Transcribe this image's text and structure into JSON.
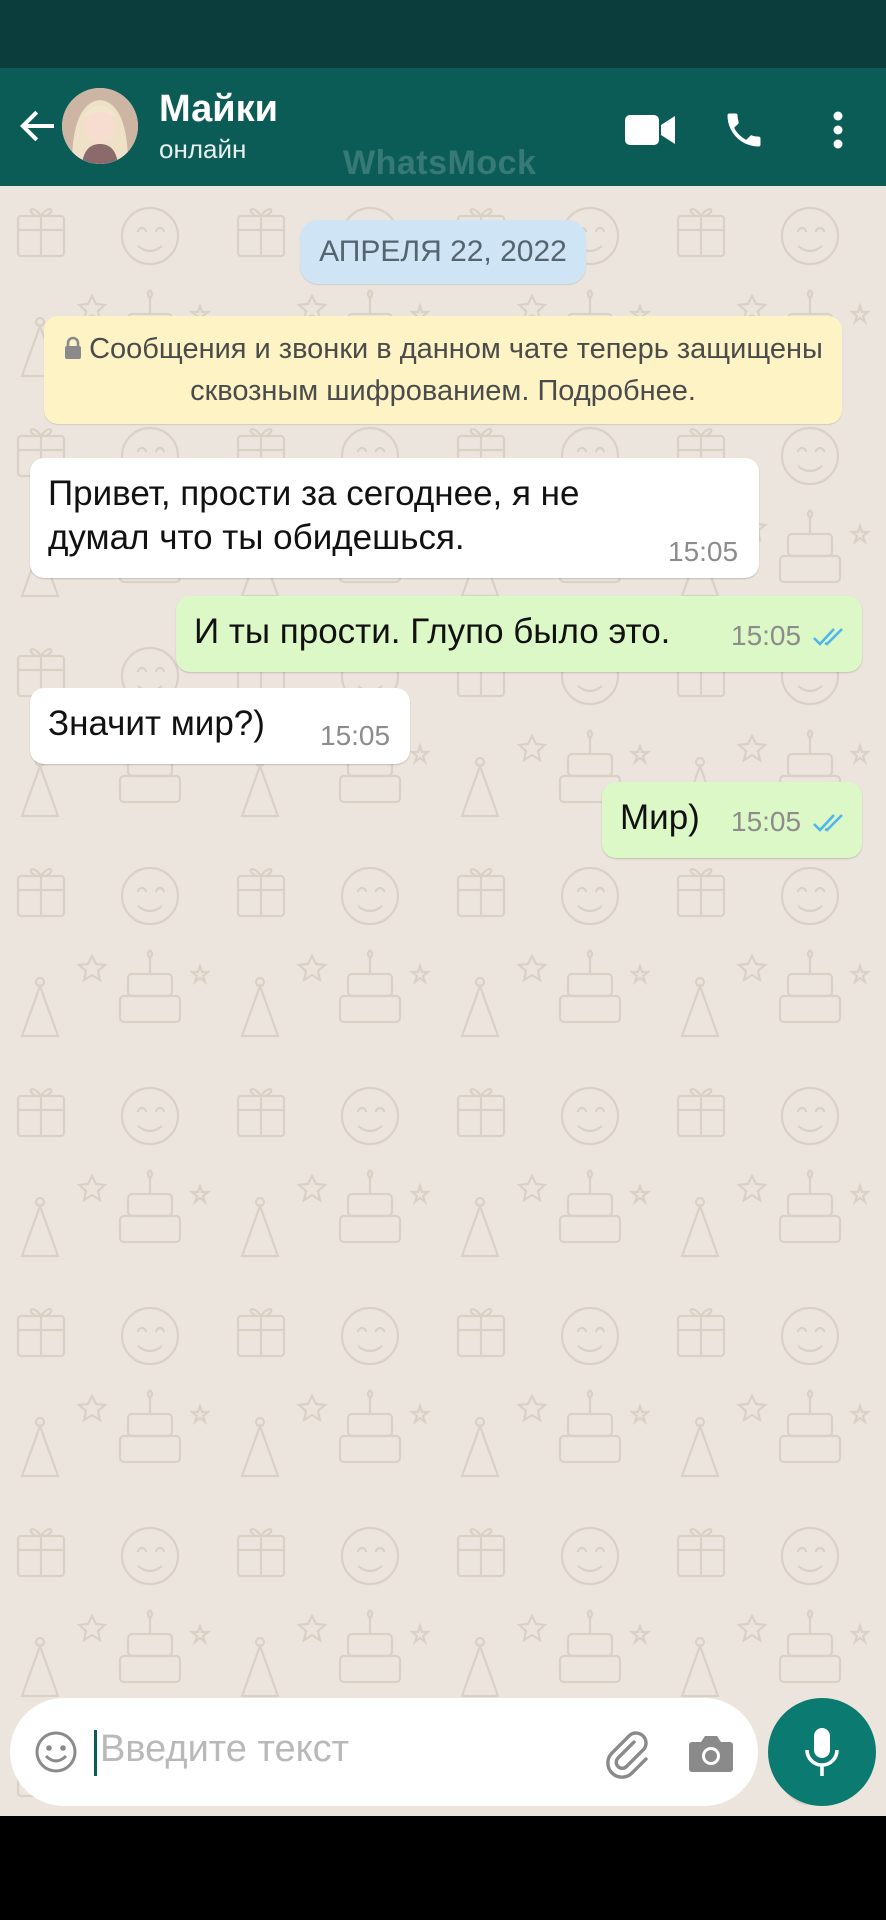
{
  "contact": {
    "name": "Майки",
    "status": "онлайн"
  },
  "watermark": "WhatsMock",
  "chat": {
    "date": "АПРЕЛЯ 22, 2022",
    "encryption_notice": "Сообщения и звонки в данном чате теперь защищены сквозным шифрованием. Подробнее.",
    "messages": [
      {
        "direction": "in",
        "text": "Привет, прости за сегоднее, я не думал что ты обидешься.",
        "time": "15:05"
      },
      {
        "direction": "out",
        "text": "И ты прости. Глупо было это.",
        "time": "15:05",
        "status": "read"
      },
      {
        "direction": "in",
        "text": "Значит мир?)",
        "time": "15:05"
      },
      {
        "direction": "out",
        "text": "Мир)",
        "time": "15:05",
        "status": "read"
      }
    ]
  },
  "input": {
    "placeholder": "Введите текст"
  },
  "icons": {
    "back": "arrow-left-icon",
    "video": "video-call-icon",
    "call": "phone-icon",
    "menu": "more-vertical-icon",
    "emoji": "emoji-icon",
    "attach": "paperclip-icon",
    "camera": "camera-icon",
    "mic": "microphone-icon",
    "lock": "lock-icon",
    "read": "double-check-icon"
  },
  "colors": {
    "header": "#0b5c57",
    "status_bar": "#0a3d3b",
    "chat_bg": "#ece5dd",
    "incoming": "#ffffff",
    "outgoing": "#dcf8c6",
    "read_ticks": "#4fb6ec",
    "mic_button": "#0b7a70",
    "date_chip": "#cfe4f4",
    "notice": "#fdf3c4"
  }
}
